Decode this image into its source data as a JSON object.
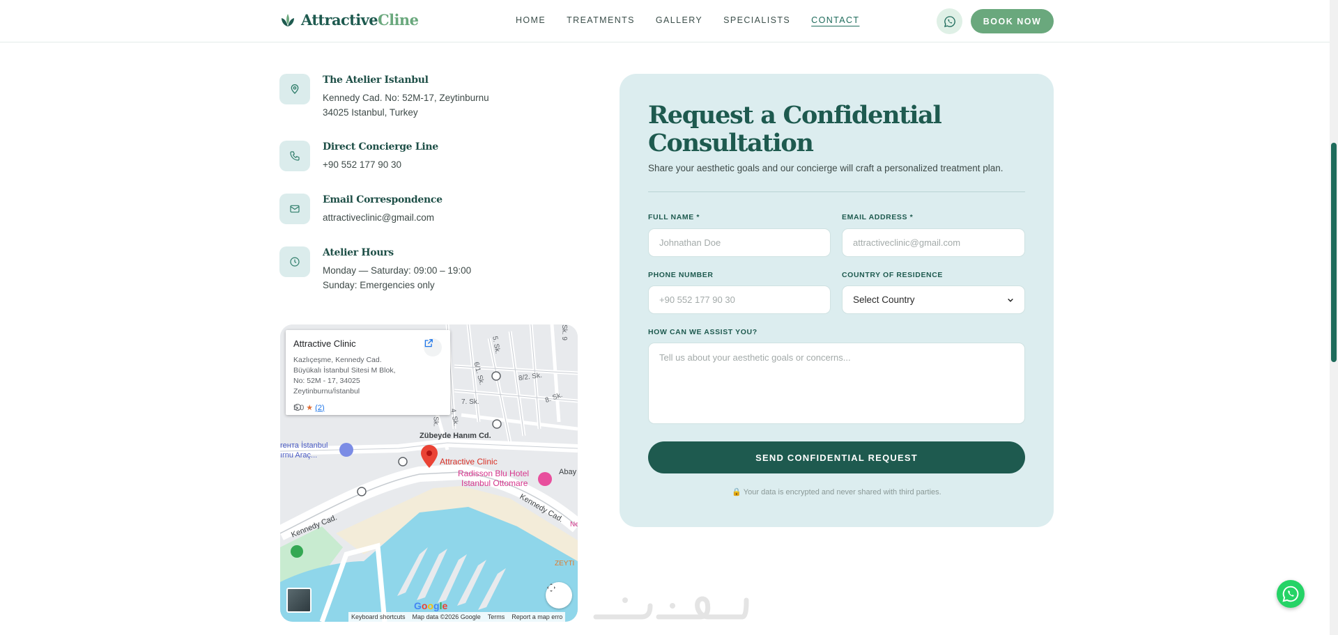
{
  "brand": {
    "name_main": "Attractive",
    "name_accent": "Cline"
  },
  "nav": {
    "items": [
      {
        "label": "HOME",
        "active": false
      },
      {
        "label": "TREATMENTS",
        "active": false
      },
      {
        "label": "GALLERY",
        "active": false
      },
      {
        "label": "SPECIALISTS",
        "active": false
      },
      {
        "label": "CONTACT",
        "active": true
      }
    ],
    "book_label": "BOOK NOW"
  },
  "contact": {
    "address": {
      "title": "The Atelier Istanbul",
      "line1": "Kennedy Cad. No: 52M-17, Zeytinburnu",
      "line2": "34025 Istanbul, Turkey"
    },
    "phone": {
      "title": "Direct Concierge Line",
      "line1": "+90 552 177 90 30"
    },
    "email": {
      "title": "Email Correspondence",
      "line1": "attractiveclinic@gmail.com"
    },
    "hours": {
      "title": "Atelier Hours",
      "line1": "Monday — Saturday: 09:00 – 19:00",
      "line2": "Sunday: Emergencies only"
    }
  },
  "map": {
    "card": {
      "title": "Attractive Clinic",
      "addr1": "Kazlıçeşme, Kennedy Cad.",
      "addr2": "Büyükalı İstanbul Sitesi M Blok,",
      "addr3": "No: 52M - 17, 34025",
      "addr4": "Zeytinburnu/İstanbul",
      "rating": "5.0",
      "reviews": "(2)"
    },
    "labels": {
      "pin": "Attractive Clinic",
      "hotel1": "Radisson Blu Hotel",
      "hotel2": "Istanbul Ottomare",
      "street1": "Zübeyde Hanım Cd.",
      "street2": "Kennedy Cad.",
      "street3": "Kennedy Cad.",
      "place1": "rента İstanbul",
      "place2": "ırnu Araç...",
      "aba": "Abay",
      "zey": "ZEYTI",
      "ne": "Ne",
      "s1": "5. Sk.",
      "s2": "6/1. Sk.",
      "s3": "8/2. Sk.",
      "s4": "7. Sk.",
      "s5": "8. Sk.",
      "s6": "4. Sk.",
      "s7": "Sk.",
      "s8": "Sk. 9"
    },
    "google": "Google",
    "footer": {
      "shortcuts": "Keyboard shortcuts",
      "data": "Map data ©2026 Google",
      "terms": "Terms",
      "report": "Report a map erro"
    }
  },
  "form": {
    "title": "Request a Confidential Consultation",
    "subtitle": "Share your aesthetic goals and our concierge will craft a personalized treatment plan.",
    "full_name": {
      "label": "FULL NAME *",
      "placeholder": "Johnathan Doe"
    },
    "email": {
      "label": "EMAIL ADDRESS *",
      "placeholder": "attractiveclinic@gmail.com"
    },
    "phone": {
      "label": "PHONE NUMBER",
      "placeholder": "+90 552 177 90 30"
    },
    "country": {
      "label": "COUNTRY OF RESIDENCE",
      "value": "Select Country"
    },
    "message": {
      "label": "HOW CAN WE ASSIST YOU?",
      "placeholder": "Tell us about your aesthetic goals or concerns..."
    },
    "submit_label": "SEND CONFIDENTIAL REQUEST",
    "privacy": "🔒 Your data is encrypted and never shared with third parties."
  },
  "watermark": "خمسات",
  "colors": {
    "primary": "#1e5a4f",
    "accent": "#6aa87d",
    "panel": "#dcedef",
    "whatsapp": "#25d366"
  },
  "icons": [
    "leaf-logo-icon",
    "whatsapp-icon",
    "location-pin-icon",
    "phone-icon",
    "mail-icon",
    "clock-icon",
    "open-external-icon",
    "fullscreen-icon"
  ]
}
